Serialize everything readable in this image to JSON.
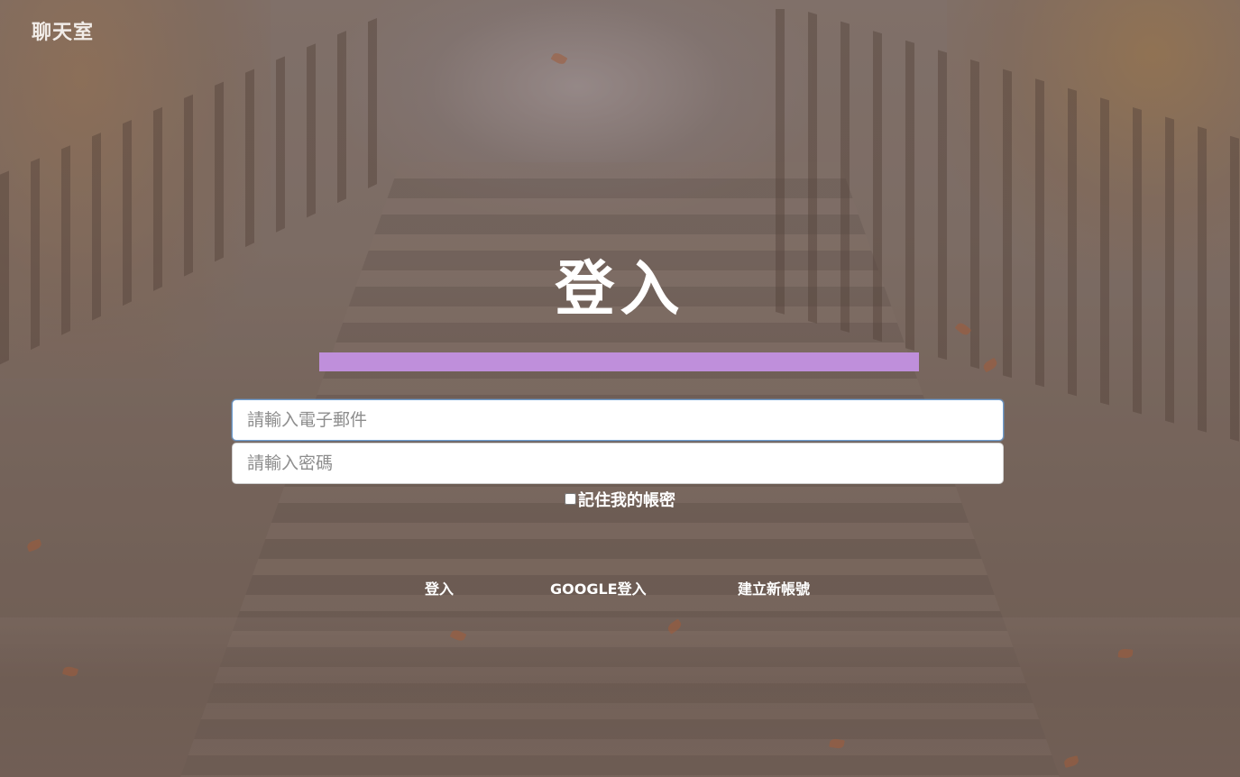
{
  "brand": {
    "title": "聊天室"
  },
  "login": {
    "heading": "登入",
    "accent_color": "#bf8fdb",
    "email_placeholder": "請輸入電子郵件",
    "password_placeholder": "請輸入密碼",
    "remember_label": "記住我的帳密",
    "remember_checked": false
  },
  "actions": {
    "login_label": "登入",
    "google_login_label": "GOOGLE登入",
    "create_account_label": "建立新帳號"
  }
}
